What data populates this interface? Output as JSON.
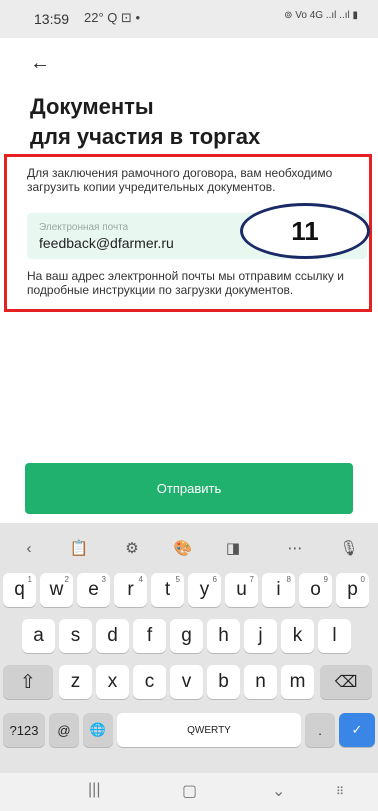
{
  "status_bar": {
    "time": "13:59",
    "left_icons": "22° Q ⊡ •",
    "right_icons": "⊚ Vo 4G ..ıl ..ıl ▮"
  },
  "header": {
    "back_icon": "arrow-left-icon"
  },
  "title": {
    "line1": "Документы",
    "line2": "для участия в торгах"
  },
  "description": "Для заключения рамочного договора, вам необходимо загрузить копии учредительных документов.",
  "email": {
    "label": "Электронная почта",
    "value": "feedback@dfarmer.ru"
  },
  "annotation": {
    "badge": "11",
    "color": "#e62020",
    "badge_border": "#1a2a66"
  },
  "info": "На ваш адрес электронной почты мы отправим ссылку и подробные инструкции по загрузки документов.",
  "send_button": {
    "label": "Отправить",
    "color": "#20b16f"
  },
  "keyboard": {
    "toolbar": [
      "‹",
      "clipboard-icon",
      "settings-icon",
      "palette-icon",
      "resize-icon",
      "more-icon",
      "mic-icon"
    ],
    "row1": [
      {
        "k": "q",
        "h": "1"
      },
      {
        "k": "w",
        "h": "2"
      },
      {
        "k": "e",
        "h": "3"
      },
      {
        "k": "r",
        "h": "4"
      },
      {
        "k": "t",
        "h": "5"
      },
      {
        "k": "y",
        "h": "6"
      },
      {
        "k": "u",
        "h": "7"
      },
      {
        "k": "i",
        "h": "8"
      },
      {
        "k": "o",
        "h": "9"
      },
      {
        "k": "p",
        "h": "0"
      }
    ],
    "row2": [
      "a",
      "s",
      "d",
      "f",
      "g",
      "h",
      "j",
      "k",
      "l"
    ],
    "row3": [
      "z",
      "x",
      "c",
      "v",
      "b",
      "n",
      "m"
    ],
    "bottom": {
      "sym": "?123",
      "at": "@",
      "space": "QWERTY",
      "dot": "."
    }
  }
}
